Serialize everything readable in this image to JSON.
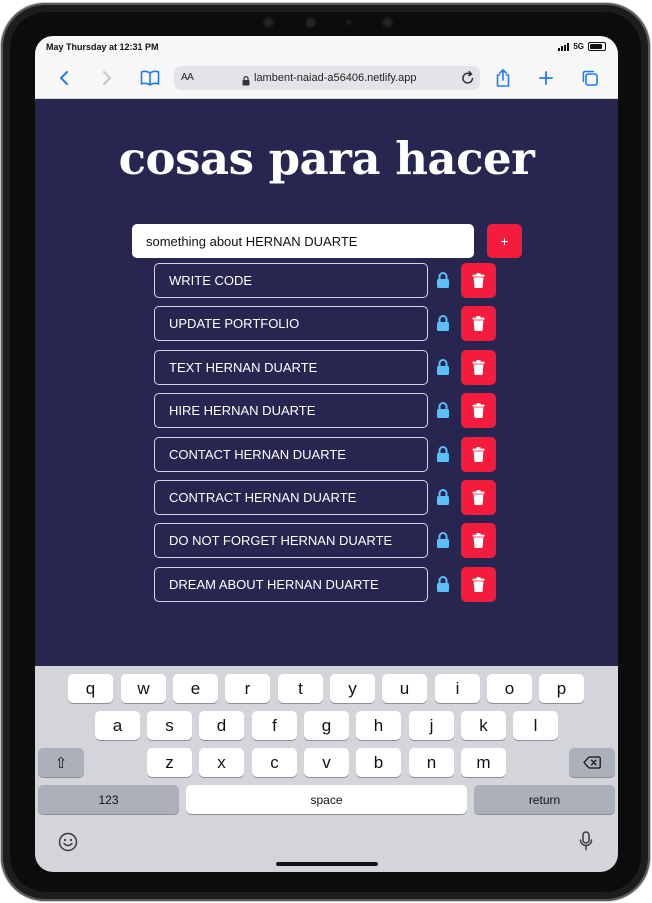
{
  "status": {
    "time": "May Thursday at 12:31 PM",
    "network": "5G"
  },
  "browser": {
    "reader_label": "AA",
    "url": "lambent-naiad-a56406.netlify.app",
    "icons": [
      "back-icon",
      "forward-icon",
      "bookmarks-icon",
      "lock-icon",
      "reload-icon",
      "share-icon",
      "new-tab-icon",
      "tabs-icon"
    ]
  },
  "page": {
    "title": "cosas para hacer",
    "input_value": "something about HERNAN DUARTE",
    "add_label": "+"
  },
  "todos": [
    {
      "text": "WRITE CODE"
    },
    {
      "text": "UPDATE PORTFOLIO"
    },
    {
      "text": "TEXT HERNAN DUARTE"
    },
    {
      "text": "HIRE HERNAN DUARTE"
    },
    {
      "text": "CONTACT HERNAN DUARTE"
    },
    {
      "text": "CONTRACT HERNAN DUARTE"
    },
    {
      "text": "DO NOT FORGET HERNAN DUARTE"
    },
    {
      "text": "DREAM ABOUT HERNAN DUARTE"
    }
  ],
  "keyboard": {
    "row1": [
      "q",
      "w",
      "e",
      "r",
      "t",
      "y",
      "u",
      "i",
      "o",
      "p"
    ],
    "row2": [
      "a",
      "s",
      "d",
      "f",
      "g",
      "h",
      "j",
      "k",
      "l"
    ],
    "row3": [
      "z",
      "x",
      "c",
      "v",
      "b",
      "n",
      "m"
    ],
    "shift": "⇧",
    "numbers": "123",
    "space": "space",
    "return": "return"
  },
  "colors": {
    "page_bg": "#272650",
    "accent_red": "#f51b3c",
    "lock_blue": "#5bc0f8",
    "safari_blue": "#1f7cf6"
  }
}
